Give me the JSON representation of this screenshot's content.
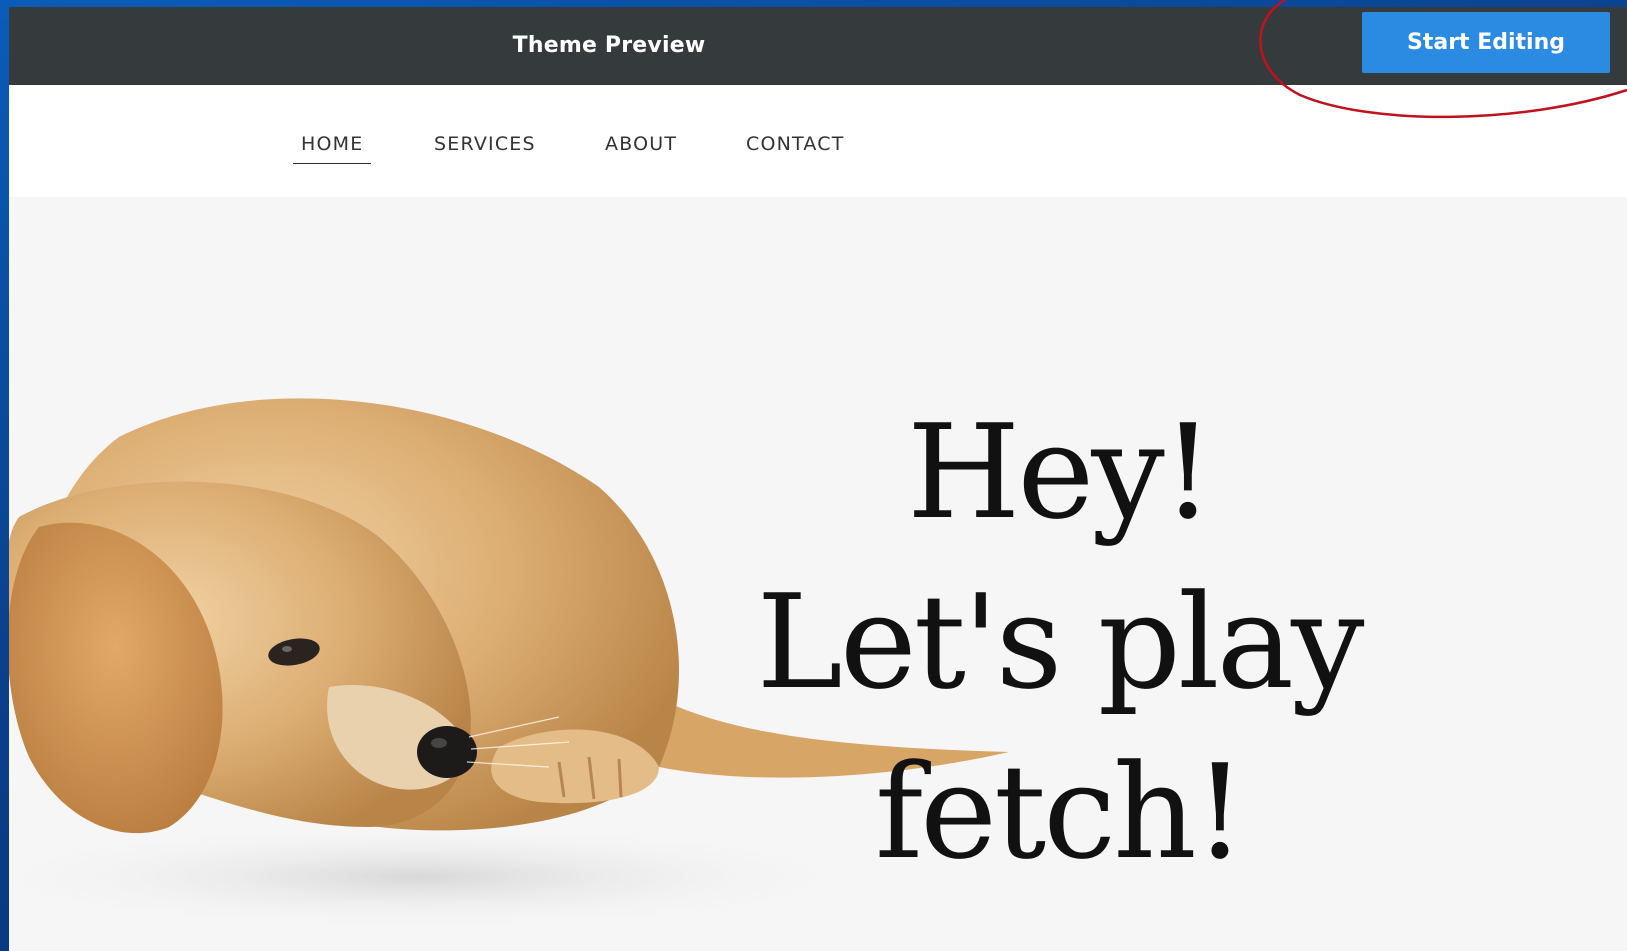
{
  "topbar": {
    "title": "Theme Preview",
    "start_button_label": "Start Editing"
  },
  "nav": {
    "items": [
      {
        "label": "HOME",
        "active": true
      },
      {
        "label": "SERVICES",
        "active": false
      },
      {
        "label": "ABOUT",
        "active": false
      },
      {
        "label": "CONTACT",
        "active": false
      }
    ]
  },
  "hero": {
    "headline_lines": [
      "Hey!",
      "Let's play",
      "fetch!"
    ],
    "image_subject": "golden-retriever-puppy"
  },
  "colors": {
    "topbar_bg": "#353a3d",
    "button_bg": "#2b8ae2",
    "annotation_circle": "#c0121d",
    "desktop_bg": "#0b5cb8"
  }
}
